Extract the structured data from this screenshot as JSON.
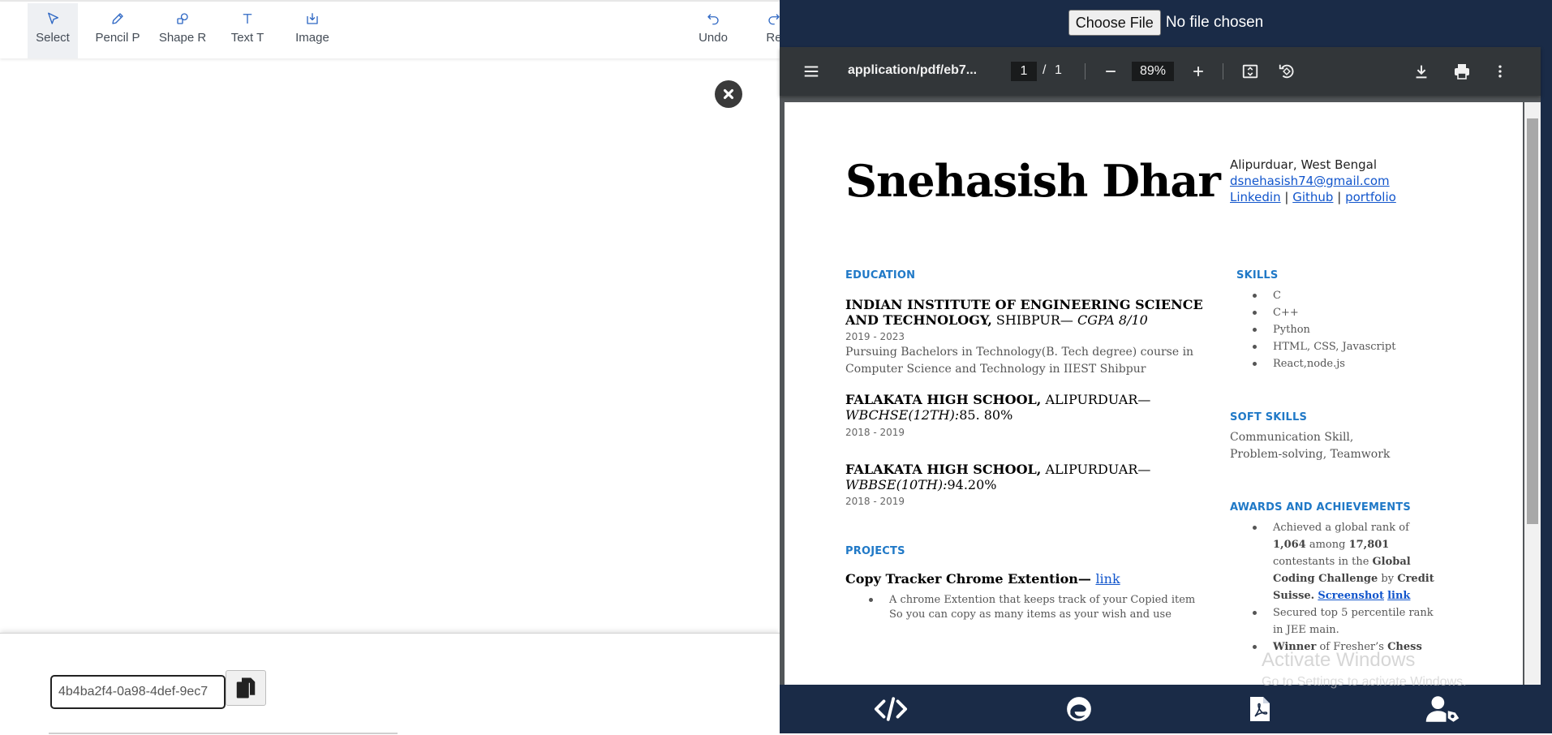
{
  "toolbar": {
    "tools": [
      {
        "label": "Select",
        "icon": "cursor-icon"
      },
      {
        "label": "Pencil P",
        "icon": "pencil-icon"
      },
      {
        "label": "Shape R",
        "icon": "shapes-icon"
      },
      {
        "label": "Text T",
        "icon": "text-icon"
      },
      {
        "label": "Image",
        "icon": "image-upload-icon"
      },
      {
        "label": "Undo",
        "icon": "undo-icon"
      },
      {
        "label": "Re",
        "icon": "redo-icon"
      }
    ]
  },
  "share": {
    "id_value": "4b4ba2f4-0a98-4def-9ec7"
  },
  "file_input": {
    "button_label": "Choose File",
    "status": "No file chosen"
  },
  "pdf_viewer": {
    "title": "application/pdf/eb7...",
    "current_page": "1",
    "page_separator": "/",
    "total_pages": "1",
    "zoom": "89%"
  },
  "resume": {
    "name": "Snehasish Dhar",
    "location": "Alipurduar, West Bengal",
    "email": "dsnehasish74@gmail.com",
    "links": [
      "Linkedin",
      "|",
      "Github",
      "|",
      "portfolio"
    ],
    "education_heading": "EDUCATION",
    "education": [
      {
        "title_bold": "INDIAN INSTITUTE OF ENGINEERING SCIENCE AND TECHNOLOGY,",
        "title_rest": " SHIBPUR— ",
        "title_italic": "CGPA 8/10",
        "date": "2019 - 2023",
        "desc": "Pursuing Bachelors in Technology(B. Tech degree) course in Computer Science and Technology in IIEST Shibpur"
      },
      {
        "title_bold": "FALAKATA HIGH SCHOOL,",
        "title_rest": " ALIPURDUAR— ",
        "title_italic": "WBCHSE(12TH):",
        "title_tail": "85. 80%",
        "date": "2018 - 2019"
      },
      {
        "title_bold": "FALAKATA HIGH SCHOOL,",
        "title_rest": " ALIPURDUAR— ",
        "title_italic": "WBBSE(10TH):",
        "title_tail": "94.20%",
        "date": "2018 - 2019"
      }
    ],
    "projects_heading": "PROJECTS",
    "project_title": "Copy Tracker Chrome Extention— ",
    "project_link": "link",
    "project_bullet_1": "A chrome Extention that keeps track of your Copied item",
    "project_bullet_2": "So you can copy as many items as your wish and use",
    "skills_heading": "SKILLS",
    "skills": [
      "C",
      "C++",
      "Python",
      "HTML, CSS, Javascript",
      "React,node.js"
    ],
    "soft_skills_heading": "SOFT SKILLS",
    "soft_skills_line1": "Communication Skill,",
    "soft_skills_line2": "Problem-solving, Teamwork",
    "awards_heading": "AWARDS AND ACHIEVEMENTS",
    "award1": {
      "t1": "Achieved a global rank of",
      "rank": "1,064",
      "among": " among ",
      "total": "17,801",
      "t2": "contestants in the ",
      "challenge1": "Global",
      "challenge2": "Coding Challenge",
      "by": " by ",
      "credit": "Credit",
      "suisse": "Suisse.",
      "screenshot": "Screenshot",
      "link": "link"
    },
    "award2_line1": "Secured top 5 percentile rank",
    "award2_line2": "in JEE main.",
    "award3_bold": "Winner",
    "award3_rest": " of Fresher’s ",
    "award3_bold2": "Chess"
  },
  "watermark": {
    "title": "Activate Windows",
    "subtitle": "Go to Settings to activate Windows."
  },
  "bottom_nav": [
    "code-icon",
    "edge-browser-icon",
    "pdf-file-icon",
    "user-settings-icon"
  ]
}
